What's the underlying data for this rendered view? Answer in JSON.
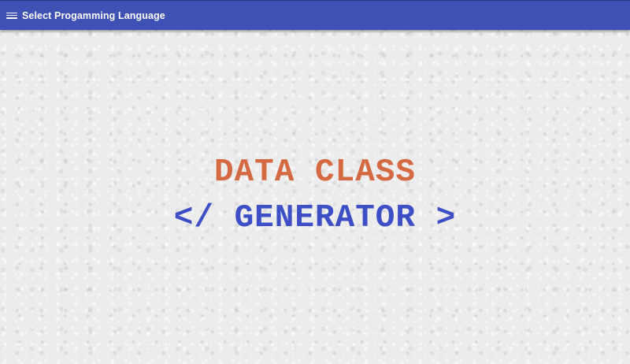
{
  "appbar": {
    "title": "Select Progamming Language",
    "menu_icon": "hamburger-menu-icon",
    "color": "#3f51b5"
  },
  "hero": {
    "line1": "DATA CLASS",
    "line2": "</ GENERATOR >",
    "line1_color": "#d56a42",
    "line2_color": "#3d4fc6"
  }
}
